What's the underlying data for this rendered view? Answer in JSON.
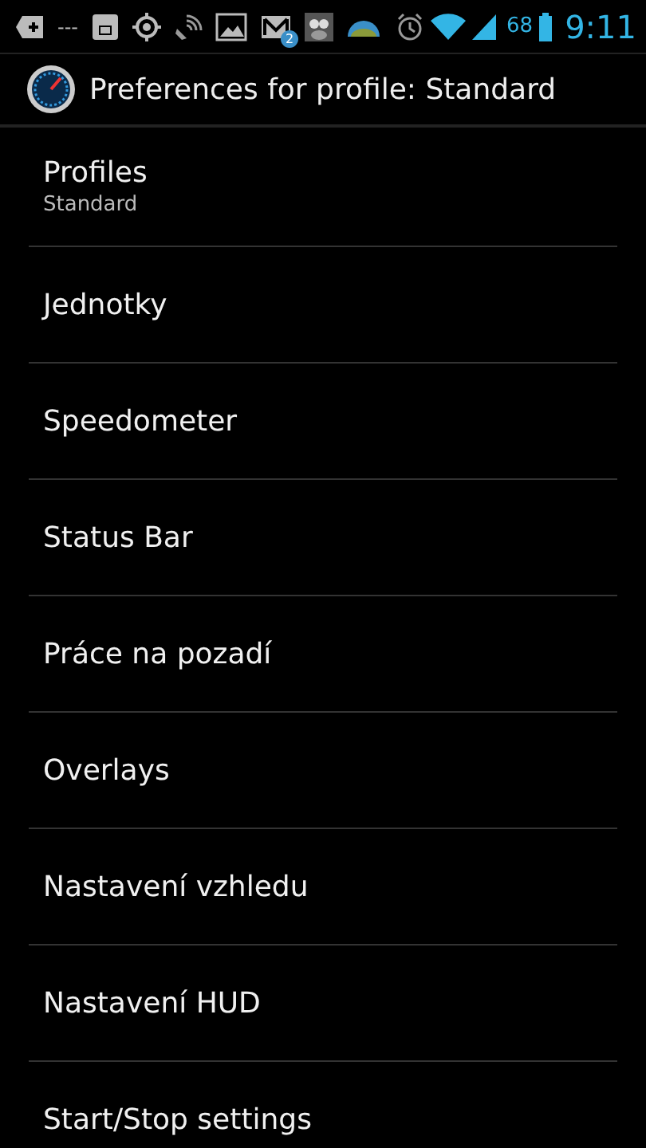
{
  "status_bar": {
    "dashes": "---",
    "mail_badge": "2",
    "battery": "68",
    "time": "9:11"
  },
  "action_bar": {
    "title": "Preferences for profile: Standard"
  },
  "items": [
    {
      "title": "Profiles",
      "summary": "Standard"
    },
    {
      "title": "Jednotky"
    },
    {
      "title": "Speedometer"
    },
    {
      "title": "Status Bar"
    },
    {
      "title": "Práce na pozadí"
    },
    {
      "title": "Overlays"
    },
    {
      "title": "Nastavení vzhledu"
    },
    {
      "title": "Nastavení HUD"
    },
    {
      "title": "Start/Stop settings"
    }
  ]
}
